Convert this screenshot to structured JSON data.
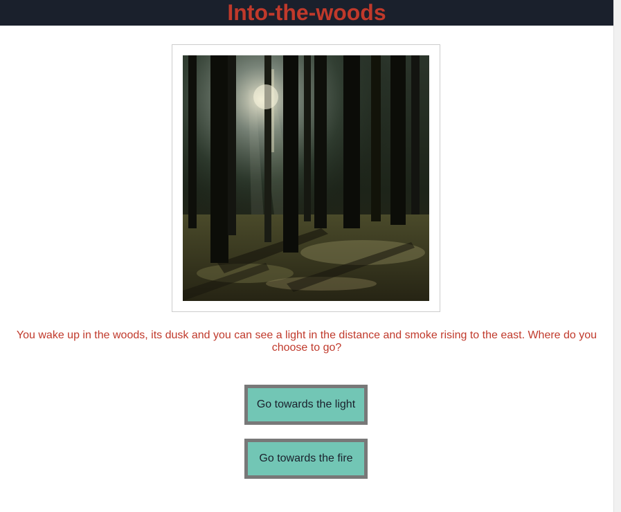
{
  "header": {
    "title": "Into-the-woods",
    "background_color": "#1a202c",
    "title_color": "#c0392b"
  },
  "scene": {
    "image_icon": "forest-image",
    "text": "You wake up in the woods, its dusk and you can see a light in the distance and smoke rising to the east. Where do you choose to go?",
    "text_color": "#c0392b"
  },
  "choices": [
    {
      "label": "Go towards the light"
    },
    {
      "label": "Go towards the fire"
    }
  ],
  "colors": {
    "button_background": "#72c6b5",
    "button_border": "#787878"
  }
}
